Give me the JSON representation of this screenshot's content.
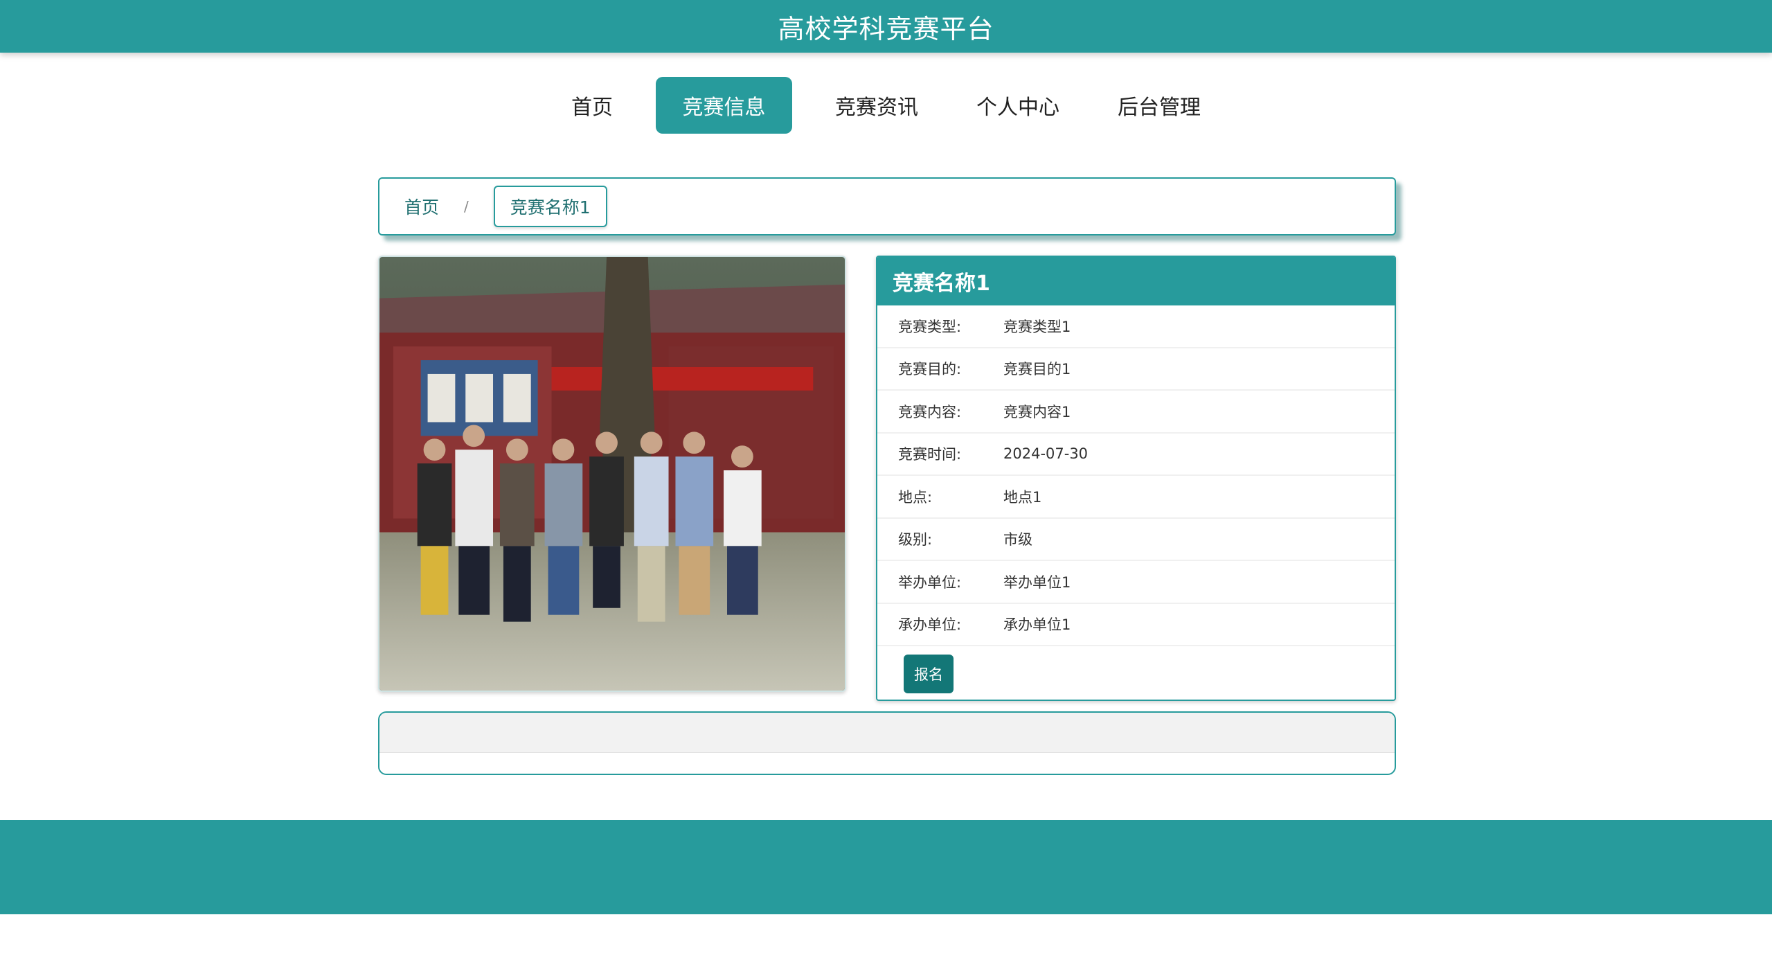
{
  "header": {
    "site_title": "高校学科竞赛平台"
  },
  "nav": {
    "items": [
      {
        "label": "首页",
        "active": false
      },
      {
        "label": "竞赛信息",
        "active": true
      },
      {
        "label": "竞赛资讯",
        "active": false
      },
      {
        "label": "个人中心",
        "active": false
      },
      {
        "label": "后台管理",
        "active": false
      }
    ]
  },
  "breadcrumb": {
    "home": "首页",
    "separator": "/",
    "current": "竞赛名称1"
  },
  "competition": {
    "title": "竞赛名称1",
    "fields": [
      {
        "label": "竞赛类型:",
        "value": "竞赛类型1"
      },
      {
        "label": "竞赛目的:",
        "value": "竞赛目的1"
      },
      {
        "label": "竞赛内容:",
        "value": "竞赛内容1"
      },
      {
        "label": "竞赛时间:",
        "value": "2024-07-30"
      },
      {
        "label": "地点:",
        "value": "地点1"
      },
      {
        "label": "级别:",
        "value": "市级"
      },
      {
        "label": "举办单位:",
        "value": "举办单位1"
      },
      {
        "label": "承办单位:",
        "value": "承办单位1"
      }
    ],
    "signup_label": "报名"
  },
  "colors": {
    "primary": "#279b9c",
    "button": "#137777"
  }
}
